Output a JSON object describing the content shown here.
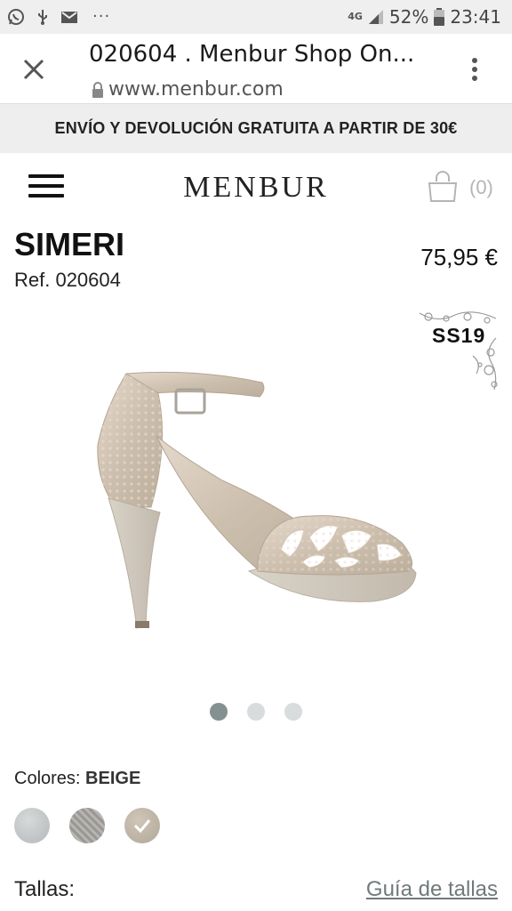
{
  "status_bar": {
    "network": "4G",
    "battery": "52%",
    "time": "23:41",
    "overflow": "···",
    "icons": [
      "whatsapp-icon",
      "usb-icon",
      "mail-icon",
      "signal-icon",
      "battery-icon"
    ]
  },
  "browser": {
    "page_title": "020604 . Menbur Shop On...",
    "url": "www.menbur.com",
    "icons": [
      "close-icon",
      "lock-icon",
      "more-vert-icon"
    ]
  },
  "banner": {
    "text": "ENVÍO Y DEVOLUCIÓN GRATUITA A PARTIR DE 30€"
  },
  "header": {
    "logo": "MENBUR",
    "cart_count": "(0)",
    "icons": [
      "menu-icon",
      "shopping-bag-icon"
    ]
  },
  "product": {
    "name": "SIMERI",
    "ref": "Ref. 020604",
    "price": "75,95 €",
    "season_badge": "SS19",
    "image_description_icon": "sandal-image",
    "carousel": {
      "count": 3,
      "active_index": 0
    }
  },
  "colors": {
    "label": "Colores:",
    "selected": "BEIGE",
    "swatches": [
      {
        "name": "silver",
        "color": "#c4c7c9"
      },
      {
        "name": "grey-glitter",
        "color": "#a8a6a2"
      },
      {
        "name": "beige",
        "color": "#c0b6a8",
        "selected": true
      }
    ]
  },
  "sizes": {
    "label": "Tallas:",
    "guide_link": "Guía de tallas"
  },
  "colors_palette": {
    "status_bg": "#efefef",
    "banner_bg": "#eeeeee",
    "dot_active": "#839191",
    "dot_inactive": "#d8dcdc",
    "link": "#6f7a7a"
  }
}
